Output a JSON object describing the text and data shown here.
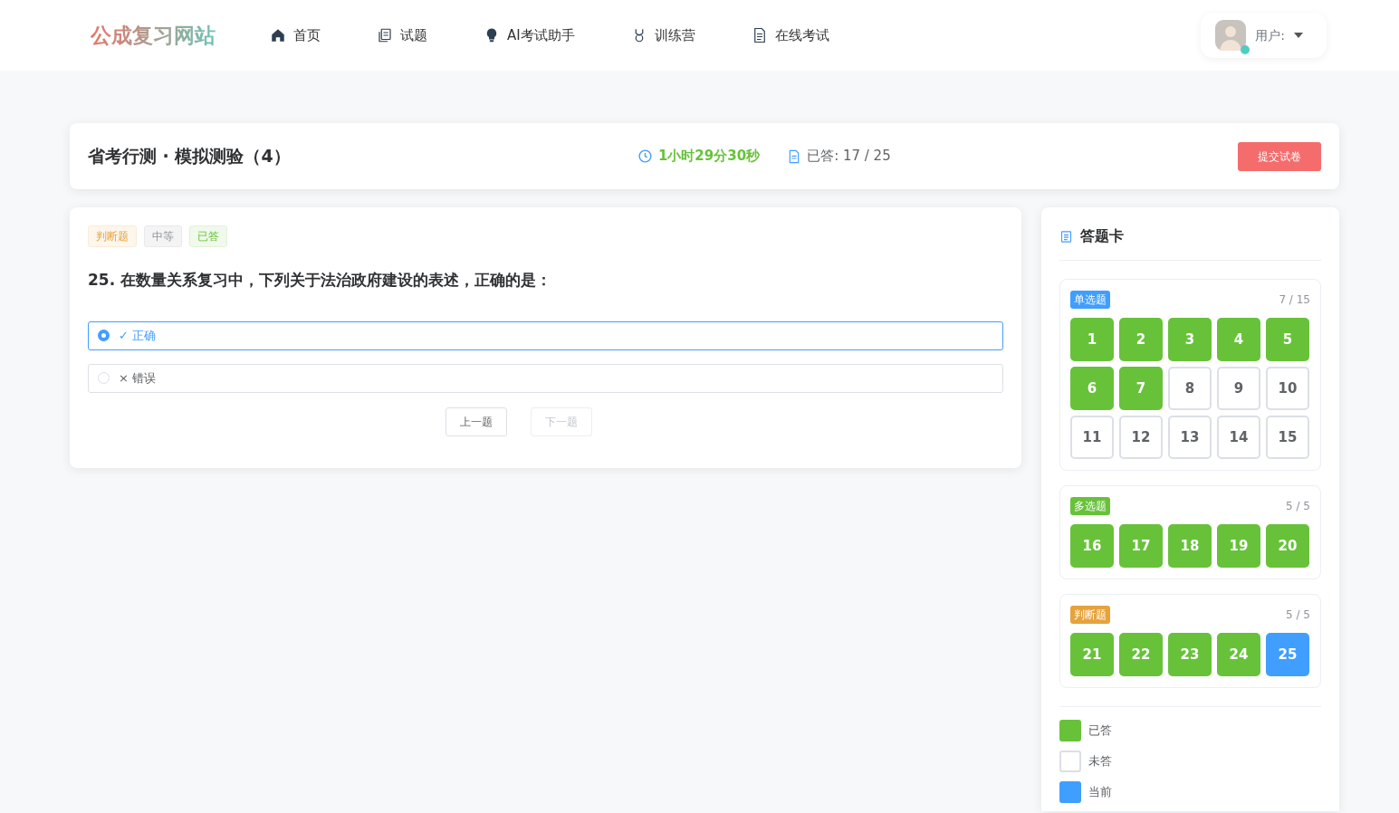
{
  "navbar": {
    "logo": "公成复习网站",
    "items": [
      {
        "label": "首页"
      },
      {
        "label": "试题"
      },
      {
        "label": "AI考试助手"
      },
      {
        "label": "训练营"
      },
      {
        "label": "在线考试"
      }
    ],
    "user": {
      "label": "用户:",
      "online": true
    }
  },
  "exam_header": {
    "title": "省考行测 · 模拟测验（4）",
    "timer": "1小时29分30秒",
    "answered": "已答: 17 / 25",
    "submit": "提交试卷"
  },
  "question": {
    "tags": [
      {
        "label": "判断题",
        "kind": "type"
      },
      {
        "label": "中等",
        "kind": "difficulty"
      },
      {
        "label": "已答",
        "kind": "status"
      }
    ],
    "text": "25. 在数量关系复习中，下列关于法治政府建设的表述，正确的是：",
    "options": [
      {
        "mark": "✓",
        "label": "正确",
        "selected": true
      },
      {
        "mark": "×",
        "label": "错误",
        "selected": false
      }
    ],
    "prev": {
      "label": "上一题",
      "disabled": false
    },
    "next": {
      "label": "下一题",
      "disabled": true
    }
  },
  "answer_card": {
    "title": "答题卡",
    "sections": [
      {
        "tag": "单选题",
        "color": "#409eff",
        "progress": "7 / 15",
        "cells": [
          {
            "n": "1",
            "kind": "answered"
          },
          {
            "n": "2",
            "kind": "answered"
          },
          {
            "n": "3",
            "kind": "answered"
          },
          {
            "n": "4",
            "kind": "answered"
          },
          {
            "n": "5",
            "kind": "answered"
          },
          {
            "n": "6",
            "kind": "answered"
          },
          {
            "n": "7",
            "kind": "answered"
          },
          {
            "n": "8",
            "kind": "unanswered"
          },
          {
            "n": "9",
            "kind": "unanswered"
          },
          {
            "n": "10",
            "kind": "unanswered"
          },
          {
            "n": "11",
            "kind": "unanswered"
          },
          {
            "n": "12",
            "kind": "unanswered"
          },
          {
            "n": "13",
            "kind": "unanswered"
          },
          {
            "n": "14",
            "kind": "unanswered"
          },
          {
            "n": "15",
            "kind": "unanswered"
          }
        ]
      },
      {
        "tag": "多选题",
        "color": "#67c23a",
        "progress": "5 / 5",
        "cells": [
          {
            "n": "16",
            "kind": "answered"
          },
          {
            "n": "17",
            "kind": "answered"
          },
          {
            "n": "18",
            "kind": "answered"
          },
          {
            "n": "19",
            "kind": "answered"
          },
          {
            "n": "20",
            "kind": "answered"
          }
        ]
      },
      {
        "tag": "判断题",
        "color": "#e6a23c",
        "progress": "5 / 5",
        "cells": [
          {
            "n": "21",
            "kind": "answered"
          },
          {
            "n": "22",
            "kind": "answered"
          },
          {
            "n": "23",
            "kind": "answered"
          },
          {
            "n": "24",
            "kind": "answered"
          },
          {
            "n": "25",
            "kind": "current"
          }
        ]
      }
    ],
    "legend": [
      {
        "label": "已答",
        "kind": "answered"
      },
      {
        "label": "未答",
        "kind": "unanswered"
      },
      {
        "label": "当前",
        "kind": "current"
      }
    ]
  }
}
